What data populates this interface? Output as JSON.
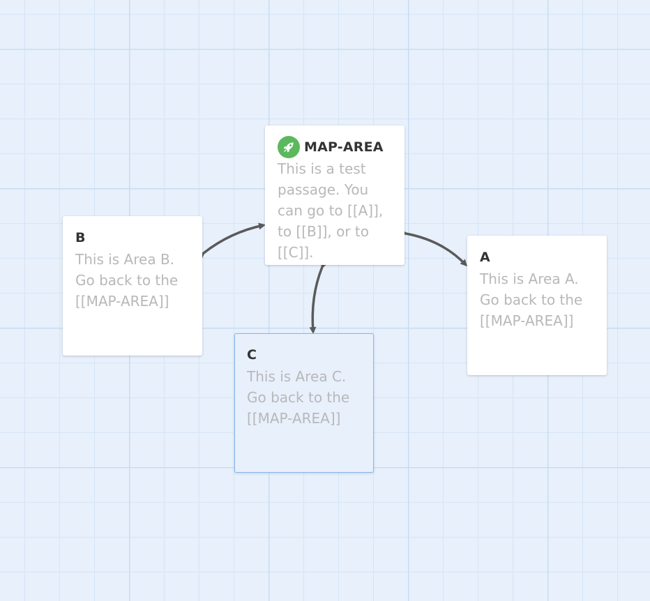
{
  "story_map": {
    "passages": [
      {
        "id": "map-area",
        "title": "MAP-AREA",
        "excerpt": "This is a test passage. You can go to [[A]], to [[B]], or to [[C]].",
        "is_start": true,
        "start_icon": "rocket-icon"
      },
      {
        "id": "b",
        "title": "B",
        "excerpt": "This is Area B. Go back to the [[MAP-AREA]]"
      },
      {
        "id": "a",
        "title": "A",
        "excerpt": "This is Area A. Go back to the [[MAP-AREA]]"
      },
      {
        "id": "c",
        "title": "C",
        "excerpt": "This is Area C. Go back to the [[MAP-AREA]]",
        "selected": true
      }
    ],
    "links": [
      {
        "from": "MAP-AREA",
        "to": "B",
        "bidirectional": true
      },
      {
        "from": "MAP-AREA",
        "to": "A",
        "bidirectional": true
      },
      {
        "from": "MAP-AREA",
        "to": "C",
        "bidirectional": true
      }
    ],
    "colors": {
      "canvas_bg": "#e7f0fb",
      "grid_major": "#c8dcf3",
      "grid_minor": "#d6e5f6",
      "passage_bg": "#ffffff",
      "selected_bg": "#e8f0fc",
      "selected_border": "#8ab6ea",
      "title_text": "#333333",
      "excerpt_text": "#b8b8b8",
      "start_icon_bg": "#5cb85c",
      "link_arrow": "#5a5a5a"
    }
  }
}
